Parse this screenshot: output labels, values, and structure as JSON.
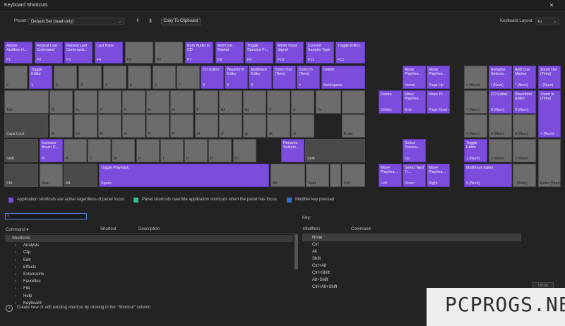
{
  "window": {
    "title": "Keyboard Shortcuts"
  },
  "toolbar": {
    "preset_label": "Preset:",
    "preset_value": "Default Set (read-only)",
    "copy_button": "Copy To Clipboard",
    "layout_label": "Keyboard Layout:",
    "layout_value": "ru"
  },
  "keys": [
    {
      "id": "f1",
      "t": "Adobe Audition H...",
      "b": "F1",
      "c": "purple"
    },
    {
      "id": "f2",
      "t": "Repeat Last Command",
      "b": "F2",
      "c": "purple"
    },
    {
      "id": "f3",
      "t": "Repeat Last Command...",
      "b": "F3",
      "c": "purple"
    },
    {
      "id": "f4",
      "t": "Last Pane",
      "b": "F4",
      "c": "purple"
    },
    {
      "id": "f5",
      "t": "",
      "b": "F5",
      "c": "gray"
    },
    {
      "id": "f6",
      "t": "",
      "b": "F6",
      "c": "gray"
    },
    {
      "id": "f7",
      "t": "Burn Audio to CD",
      "b": "F7",
      "c": "purple"
    },
    {
      "id": "f8",
      "t": "Add Cue Marker",
      "b": "F8",
      "c": "purple"
    },
    {
      "id": "f9",
      "t": "Toggle Spectral Fr...",
      "b": "F9",
      "c": "purple"
    },
    {
      "id": "f10",
      "t": "Meter Input Signal",
      "b": "F10",
      "c": "purple"
    },
    {
      "id": "f11",
      "t": "Convert Sample Type",
      "b": "F11",
      "c": "purple"
    },
    {
      "id": "f12",
      "t": "Toggle Editor",
      "b": "F12",
      "c": "purple"
    },
    {
      "id": "tilde",
      "t": "",
      "b": "ё",
      "c": "gray"
    },
    {
      "id": "k1",
      "t": "Toggle Editor",
      "b": "1",
      "c": "purple"
    },
    {
      "id": "k2",
      "t": "",
      "b": "2",
      "c": "gray"
    },
    {
      "id": "k3",
      "t": "",
      "b": "3",
      "c": "gray"
    },
    {
      "id": "k4",
      "t": "",
      "b": "4",
      "c": "gray"
    },
    {
      "id": "k5",
      "t": "",
      "b": "5",
      "c": "gray"
    },
    {
      "id": "k6",
      "t": "",
      "b": "6",
      "c": "gray"
    },
    {
      "id": "k7",
      "t": "",
      "b": "7",
      "c": "gray"
    },
    {
      "id": "k8",
      "t": "CD Editor",
      "b": "8",
      "c": "purple"
    },
    {
      "id": "k9",
      "t": "Waveform Editor",
      "b": "9",
      "c": "purple"
    },
    {
      "id": "k0",
      "t": "Multitrack Editor",
      "b": "0",
      "c": "purple"
    },
    {
      "id": "kminus",
      "t": "Zoom Out (Time)",
      "b": "-",
      "c": "purple"
    },
    {
      "id": "keq",
      "t": "Zoom In (Time)",
      "b": "=",
      "c": "purple"
    },
    {
      "id": "kbs",
      "t": "Delete",
      "b": "Backspace",
      "c": "purple"
    },
    {
      "id": "tab",
      "t": "",
      "b": "Tab",
      "c": "gray"
    },
    {
      "id": "q",
      "t": "",
      "b": "Й",
      "c": "gray"
    },
    {
      "id": "w",
      "t": "",
      "b": "Ц",
      "c": "gray"
    },
    {
      "id": "e",
      "t": "",
      "b": "У",
      "c": "gray"
    },
    {
      "id": "r",
      "t": "",
      "b": "К",
      "c": "gray"
    },
    {
      "id": "ty",
      "t": "",
      "b": "Е",
      "c": "gray"
    },
    {
      "id": "y",
      "t": "",
      "b": "Н",
      "c": "gray"
    },
    {
      "id": "u",
      "t": "",
      "b": "Г",
      "c": "gray"
    },
    {
      "id": "i",
      "t": "",
      "b": "Ш",
      "c": "gray"
    },
    {
      "id": "o",
      "t": "",
      "b": "Щ",
      "c": "gray"
    },
    {
      "id": "p",
      "t": "",
      "b": "З",
      "c": "gray"
    },
    {
      "id": "lb",
      "t": "",
      "b": "Х",
      "c": "gray"
    },
    {
      "id": "rb",
      "t": "",
      "b": "Ъ",
      "c": "gray"
    },
    {
      "id": "bsl",
      "t": "",
      "b": "",
      "c": "gray"
    },
    {
      "id": "caps",
      "t": "",
      "b": "Caps Lock",
      "c": "dark"
    },
    {
      "id": "a",
      "t": "",
      "b": "Ф",
      "c": "gray"
    },
    {
      "id": "s",
      "t": "",
      "b": "Ы",
      "c": "gray"
    },
    {
      "id": "d",
      "t": "",
      "b": "В",
      "c": "gray"
    },
    {
      "id": "f",
      "t": "",
      "b": "А",
      "c": "gray"
    },
    {
      "id": "g",
      "t": "",
      "b": "П",
      "c": "gray"
    },
    {
      "id": "h",
      "t": "",
      "b": "Р",
      "c": "gray"
    },
    {
      "id": "j",
      "t": "",
      "b": "О",
      "c": "gray"
    },
    {
      "id": "k",
      "t": "",
      "b": "Л",
      "c": "gray"
    },
    {
      "id": "l",
      "t": "",
      "b": "Д",
      "c": "gray"
    },
    {
      "id": "semi",
      "t": "",
      "b": "Ж",
      "c": "gray"
    },
    {
      "id": "quote",
      "t": "",
      "b": "Э",
      "c": "gray"
    },
    {
      "id": "enter",
      "t": "",
      "b": "Enter",
      "c": "gray"
    },
    {
      "id": "lshift",
      "t": "",
      "b": "Shift",
      "c": "dark"
    },
    {
      "id": "z",
      "t": "Increase Brush S...",
      "b": "Я",
      "c": "purple"
    },
    {
      "id": "x",
      "t": "",
      "b": "Ч",
      "c": "gray"
    },
    {
      "id": "cc",
      "t": "",
      "b": "С",
      "c": "gray"
    },
    {
      "id": "v",
      "t": "",
      "b": "М",
      "c": "gray"
    },
    {
      "id": "bb",
      "t": "",
      "b": "И",
      "c": "gray"
    },
    {
      "id": "n",
      "t": "",
      "b": "Т",
      "c": "gray"
    },
    {
      "id": "m",
      "t": "",
      "b": "Ь",
      "c": "gray"
    },
    {
      "id": "comma",
      "t": "",
      "b": "Б",
      "c": "gray"
    },
    {
      "id": "period",
      "t": "",
      "b": "Ю",
      "c": "gray"
    },
    {
      "id": "slash",
      "t": "Rename Selecte...",
      "b": ".",
      "c": "purple"
    },
    {
      "id": "rshift",
      "t": "",
      "b": "Shift",
      "c": "dark"
    },
    {
      "id": "lctrl",
      "t": "",
      "b": "Ctrl",
      "c": "dark"
    },
    {
      "id": "lwin",
      "t": "",
      "b": "Start",
      "c": "gray"
    },
    {
      "id": "lalt",
      "t": "",
      "b": "Alt",
      "c": "dark"
    },
    {
      "id": "space",
      "t": "Toggle Playback",
      "b": "Space",
      "c": "purple"
    },
    {
      "id": "ralt",
      "t": "",
      "b": "Alt",
      "c": "gray"
    },
    {
      "id": "rwin",
      "t": "",
      "b": "Start",
      "c": "gray"
    },
    {
      "id": "menu",
      "t": "",
      "b": "",
      "c": "gray"
    },
    {
      "id": "rctrl",
      "t": "",
      "b": "Ctrl",
      "c": "gray"
    },
    {
      "id": "ins",
      "t": "Move Playhea...",
      "b": "Home",
      "c": "purple"
    },
    {
      "id": "pgup",
      "t": "Move Playhea...",
      "b": "Page Up",
      "c": "purple"
    },
    {
      "id": "del",
      "t": "Delete",
      "b": "Delete",
      "c": "purple"
    },
    {
      "id": "end",
      "t": "Move Playhea...",
      "b": "End",
      "c": "purple"
    },
    {
      "id": "pgdn",
      "t": "Move Pl...",
      "b": "Page Down",
      "c": "purple"
    },
    {
      "id": "up",
      "t": "Select Previou...",
      "b": "Up",
      "c": "purple"
    },
    {
      "id": "left",
      "t": "Move Playhea...",
      "b": "Left",
      "c": "purple"
    },
    {
      "id": "down",
      "t": "Select Next Tr...",
      "b": "Down",
      "c": "purple"
    },
    {
      "id": "right",
      "t": "Move Playhea...",
      "b": "Right",
      "c": "purple"
    },
    {
      "id": "numlk",
      "t": "",
      "b": "= (Num)",
      "c": "gray"
    },
    {
      "id": "numdiv",
      "t": "Rename Selecte...",
      "b": "/ (Num)",
      "c": "purple"
    },
    {
      "id": "nummul",
      "t": "Add Cue Marker",
      "b": "* (Num)",
      "c": "purple"
    },
    {
      "id": "numsub",
      "t": "Zoom Out (Time)",
      "b": "- (Num)",
      "c": "purple"
    },
    {
      "id": "num7",
      "t": "",
      "b": "7 (Num)",
      "c": "gray"
    },
    {
      "id": "num8",
      "t": "CD Editor",
      "b": "8 (Num)",
      "c": "purple"
    },
    {
      "id": "num9",
      "t": "Waveform Editor",
      "b": "9 (Num)",
      "c": "purple"
    },
    {
      "id": "numadd",
      "t": "Zoom In (Time)",
      "b": "+ (Num)",
      "c": "purple"
    },
    {
      "id": "num4",
      "t": "",
      "b": "4 (Num)",
      "c": "gray"
    },
    {
      "id": "num5",
      "t": "",
      "b": "5 (Num)",
      "c": "gray"
    },
    {
      "id": "num6",
      "t": "",
      "b": "6 (Num)",
      "c": "gray"
    },
    {
      "id": "num1",
      "t": "Toggle Editor",
      "b": "1 (Num)",
      "c": "purple"
    },
    {
      "id": "num2",
      "t": "",
      "b": "2 (Num)",
      "c": "gray"
    },
    {
      "id": "num3",
      "t": "",
      "b": "3 (Num)",
      "c": "gray"
    },
    {
      "id": "numenter",
      "t": "",
      "b": "Enter (Num)",
      "c": "gray"
    },
    {
      "id": "num0",
      "t": "Multitrack Editor",
      "b": "0 (Num)",
      "c": "purple"
    },
    {
      "id": "numdot",
      "t": "",
      "b": ". (Num)",
      "c": "gray"
    }
  ],
  "legend": {
    "purple_text": "Application shortcuts are active regardless of panel focus",
    "purple_color": "#7c4ddd",
    "green_text": "Panel shortcuts override application shortcuts when the panel has focus",
    "green_color": "#2fbf8f",
    "blue_text": "Modifier key pressed",
    "blue_color": "#2f6fd6"
  },
  "commands": {
    "headers": {
      "command": "Command",
      "shortcut": "Shortcut",
      "description": "Description"
    },
    "rows": [
      "Shortcuts",
      "Analysis",
      "Clip",
      "Edit",
      "Effects",
      "Extensions",
      "Favorites",
      "File",
      "Help",
      "Keyboard"
    ]
  },
  "key_panel": {
    "title": "Key:",
    "headers": {
      "modifiers": "Modifiers",
      "command": "Command"
    },
    "rows": [
      "None",
      "Ctrl",
      "Alt",
      "Shift",
      "Ctrl+Alt",
      "Ctrl+Shift",
      "Alt+Shift",
      "Ctrl+Alt+Shift"
    ]
  },
  "status": {
    "text": "Create new or edit existing shortcut by clicking in the \"Shortcut\" column"
  },
  "buttons": {
    "undo": "Undo"
  },
  "watermark": {
    "text": "PCPROGS.NET"
  }
}
